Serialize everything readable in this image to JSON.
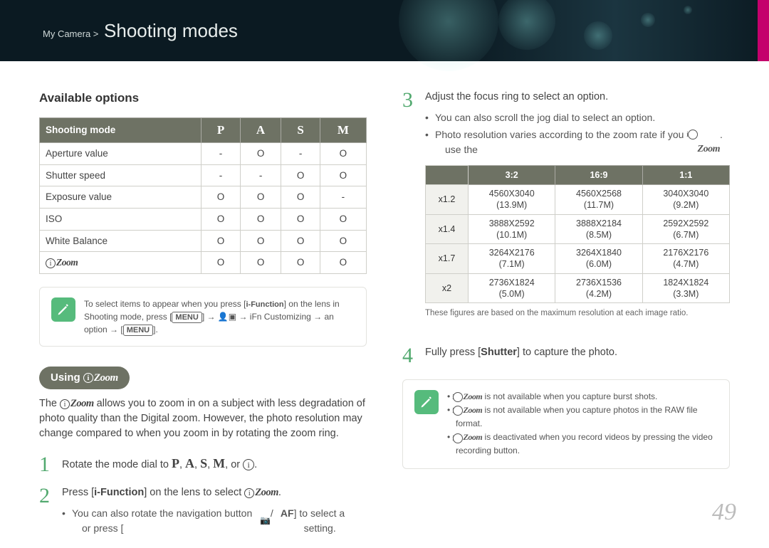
{
  "header": {
    "breadcrumb_prefix": "My Camera >",
    "title": "Shooting modes"
  },
  "left": {
    "heading": "Available options",
    "table_header_first": "Shooting mode",
    "table_columns": [
      "P",
      "A",
      "S",
      "M"
    ],
    "table_rows": [
      {
        "label": "Aperture value",
        "cells": [
          "-",
          "O",
          "-",
          "O"
        ]
      },
      {
        "label": "Shutter speed",
        "cells": [
          "-",
          "-",
          "O",
          "O"
        ]
      },
      {
        "label": "Exposure value",
        "cells": [
          "O",
          "O",
          "O",
          "-"
        ]
      },
      {
        "label": "ISO",
        "cells": [
          "O",
          "O",
          "O",
          "O"
        ]
      },
      {
        "label": "White Balance",
        "cells": [
          "O",
          "O",
          "O",
          "O"
        ]
      },
      {
        "label": "__izoom__",
        "cells": [
          "O",
          "O",
          "O",
          "O"
        ]
      }
    ],
    "note_prefix": "To select items to appear when you press ",
    "note_key_ifn": "i-Function",
    "note_mid": " on the lens in Shooting mode, press ",
    "note_key_menu": "MENU",
    "note_tail1": " → ",
    "note_tail2": " → iFn Customizing → an option → ",
    "using_label": "Using ",
    "para": " allows you to zoom in on a subject with less degradation of photo quality than the Digital zoom. However, the photo resolution may change compared to when you zoom in by rotating the zoom ring.",
    "para_prefix": "The ",
    "steps": {
      "s1_pre": "Rotate the mode dial to ",
      "s1_modes_sep": ", ",
      "s1_or": ", or ",
      "s1_end": ".",
      "s2_pre": "Press [",
      "s2_key": "i-Function",
      "s2_mid": "] on the lens to select ",
      "s2_end": ".",
      "s2_sub_pre": "You can also rotate the navigation button or press [",
      "s2_sub_mid": "/",
      "s2_sub_af": "AF",
      "s2_sub_end": "] to select a setting."
    }
  },
  "right": {
    "s3_text": "Adjust the focus ring to select an option.",
    "s3_sub1": "You can also scroll the jog dial to select an option.",
    "s3_sub2_pre": "Photo resolution varies according to the zoom rate if you use the ",
    "s3_sub2_end": ".",
    "res_headers": [
      "",
      "3:2",
      "16:9",
      "1:1"
    ],
    "res_rows": [
      {
        "label": "x1.2",
        "cells": [
          [
            "4560X3040",
            "(13.9M)"
          ],
          [
            "4560X2568",
            "(11.7M)"
          ],
          [
            "3040X3040",
            "(9.2M)"
          ]
        ]
      },
      {
        "label": "x1.4",
        "cells": [
          [
            "3888X2592",
            "(10.1M)"
          ],
          [
            "3888X2184",
            "(8.5M)"
          ],
          [
            "2592X2592",
            "(6.7M)"
          ]
        ]
      },
      {
        "label": "x1.7",
        "cells": [
          [
            "3264X2176",
            "(7.1M)"
          ],
          [
            "3264X1840",
            "(6.0M)"
          ],
          [
            "2176X2176",
            "(4.7M)"
          ]
        ]
      },
      {
        "label": "x2",
        "cells": [
          [
            "2736X1824",
            "(5.0M)"
          ],
          [
            "2736X1536",
            "(4.2M)"
          ],
          [
            "1824X1824",
            "(3.3M)"
          ]
        ]
      }
    ],
    "caption": "These figures are based on the maximum resolution at each image ratio.",
    "s4_pre": "Fully press [",
    "s4_key": "Shutter",
    "s4_end": "] to capture the photo.",
    "note_items": [
      " is not available when you capture burst shots.",
      " is not available when you capture photos in the RAW file format.",
      " is deactivated when you record videos by pressing the video recording button."
    ]
  },
  "page_number": "49"
}
